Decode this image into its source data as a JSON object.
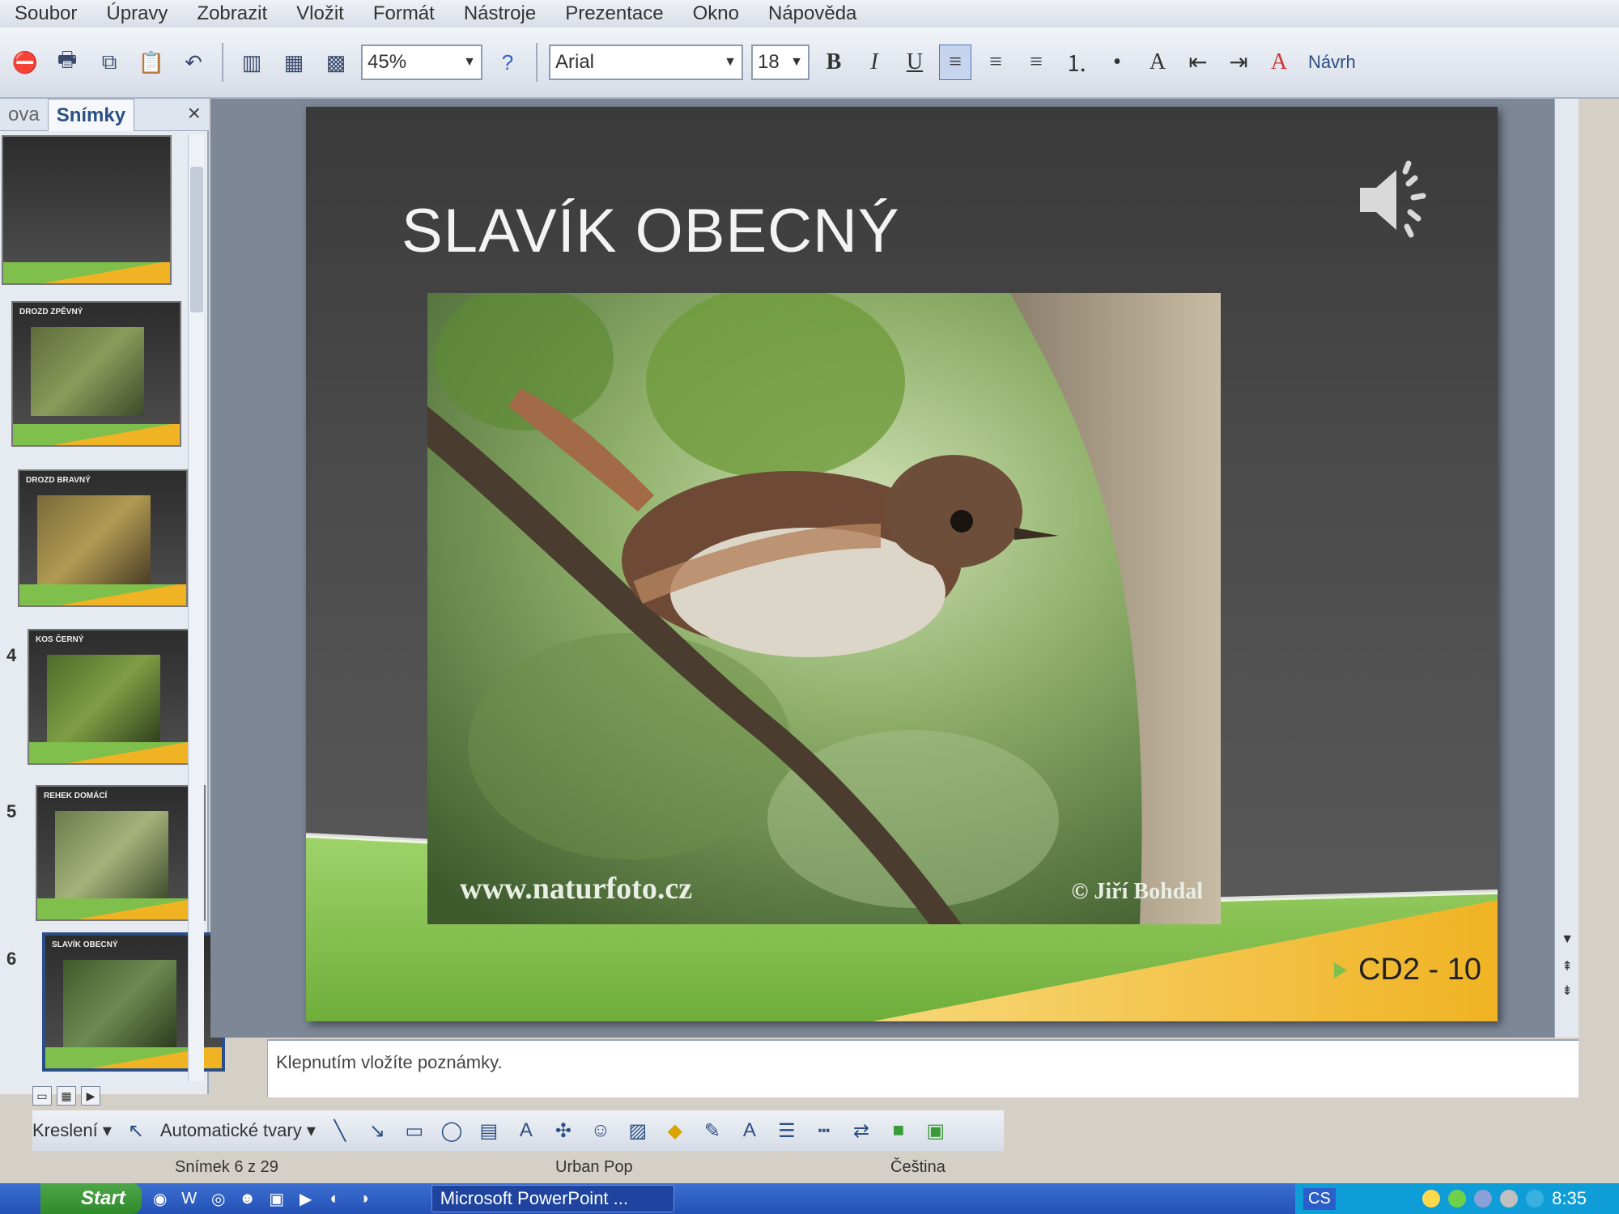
{
  "menu": [
    "Soubor",
    "Úpravy",
    "Zobrazit",
    "Vložit",
    "Formát",
    "Nástroje",
    "Prezentace",
    "Okno",
    "Nápověda"
  ],
  "toolbar": {
    "zoom": "45%",
    "font_name": "Arial",
    "font_size": "18",
    "bold": "B",
    "italic": "I",
    "underline": "U",
    "design_button": "Návrh"
  },
  "slides_pane": {
    "tab_outline": "ova",
    "tab_slides": "Snímky",
    "close": "×",
    "thumbnails": [
      {
        "num": "",
        "title": "",
        "selected": false
      },
      {
        "num": "",
        "title": "DROZD ZPĚVNÝ",
        "selected": false
      },
      {
        "num": "",
        "title": "DROZD BRAVNÝ",
        "selected": false
      },
      {
        "num": "4",
        "title": "KOS ČERNÝ",
        "selected": false
      },
      {
        "num": "5",
        "title": "REHEK DOMÁCÍ",
        "selected": false
      },
      {
        "num": "6",
        "title": "SLAVÍK OBECNÝ",
        "selected": true
      }
    ]
  },
  "slide": {
    "title": "SLAVÍK OBECNÝ",
    "photo_watermark": "www.naturfoto.cz",
    "photo_credit": "© Jiří Bohdal",
    "code": "CD2 - 10"
  },
  "notes": {
    "placeholder": "Klepnutím vložíte poznámky."
  },
  "drawing_toolbar": {
    "draw_label": "Kreslení ▾",
    "autoshapes_label": "Automatické tvary ▾"
  },
  "status": {
    "slide_counter": "Snímek 6 z 29",
    "design": "Urban Pop",
    "language": "Čeština"
  },
  "taskbar": {
    "start": "Start",
    "ppt_task": "Microsoft PowerPoint ...",
    "lang": "CS",
    "clock": "8:35"
  },
  "colors": {
    "slide_green": "#7fbf4b",
    "slide_yellow": "#f0b323",
    "selection_blue": "#2b4e88"
  }
}
